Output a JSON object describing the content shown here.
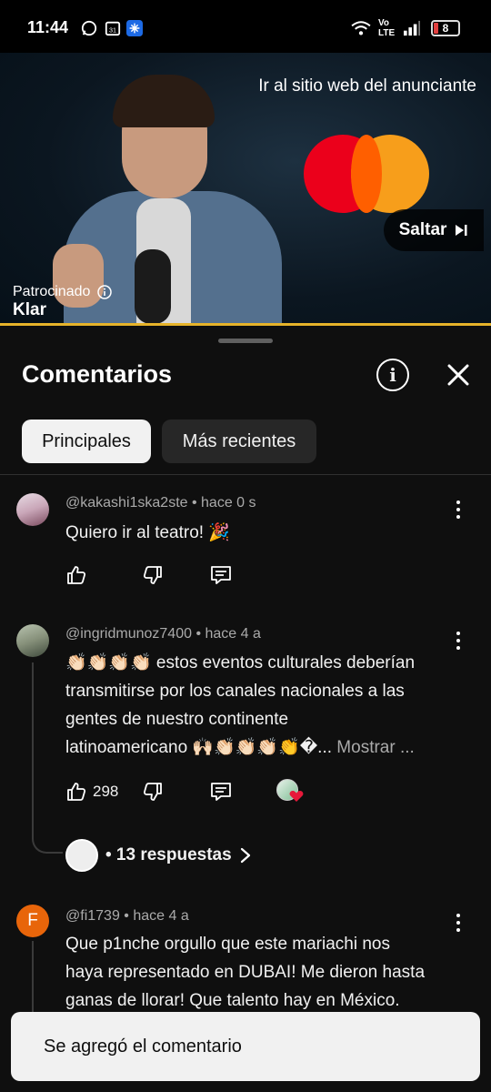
{
  "status_bar": {
    "time": "11:44",
    "battery": "8",
    "network_label": "Vo LTE"
  },
  "ad": {
    "advertiser_link": "Ir al sitio web del anunciante",
    "skip_label": "Saltar",
    "sponsored_label": "Patrocinado",
    "brand_name": "Klar",
    "progress_fraction": 1.0
  },
  "comments_panel": {
    "title": "Comentarios",
    "chips": [
      {
        "label": "Principales",
        "active": true
      },
      {
        "label": "Más recientes",
        "active": false
      }
    ],
    "comments": [
      {
        "author": "@kakashi1ska2ste",
        "time": "hace 0 s",
        "text": "Quiero ir al teatro! 🎉",
        "likes": ""
      },
      {
        "author": "@ingridmunoz7400",
        "time": "hace 4 a",
        "text_lines": [
          "👏🏻👏🏻👏🏻👏🏻 estos eventos culturales deberían",
          "transmitirse por los canales nacionales a las",
          "gentes de nuestro continente",
          "latinoamericano 🙌🏻👏🏻👏🏻👏🏻👏�..."
        ],
        "show_more": "Mostrar ...",
        "likes": "298",
        "replies_label": "• 13 respuestas"
      },
      {
        "author": "@fi1739",
        "avatar_letter": "F",
        "time": "hace 4 a",
        "text_lines": [
          "Que p1nche orgullo que este mariachi nos",
          "haya representado en DUBAI! Me dieron hasta",
          "ganas de llorar! Que talento hay en México."
        ]
      }
    ]
  },
  "toast": {
    "message": "Se agregó el comentario"
  },
  "colors": {
    "background": "#0f0f0f",
    "ad_progress": "#e6b32a",
    "avatar_f": "#e8650a",
    "heart": "#e6193a"
  },
  "icons": [
    "whatsapp-icon",
    "calendar-icon",
    "snowflake-icon",
    "wifi-icon",
    "signal-icon",
    "info-icon",
    "close-icon",
    "like-icon",
    "dislike-icon",
    "reply-icon",
    "more-vert-icon",
    "chevron-right-icon",
    "skip-icon"
  ]
}
